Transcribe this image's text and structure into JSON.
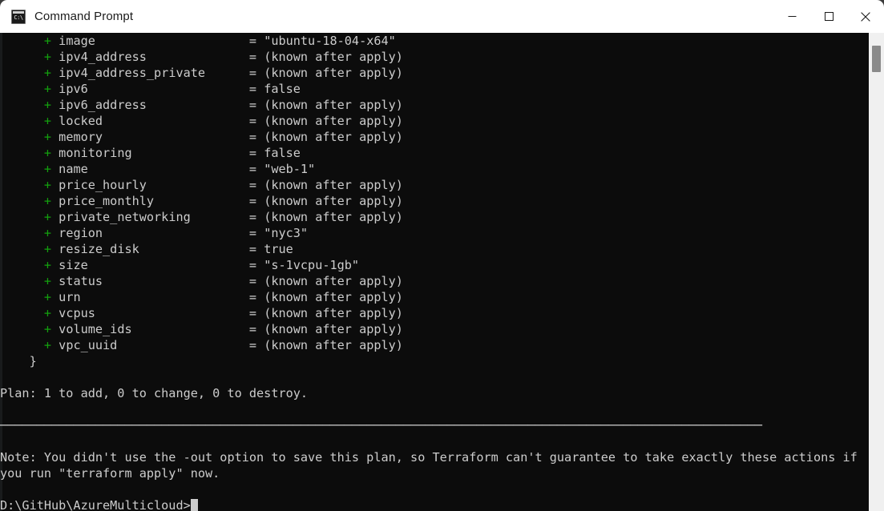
{
  "window": {
    "title": "Command Prompt",
    "icon": "cmd-prompt-icon",
    "icon_glyph": "C:\\",
    "controls": {
      "minimize": "Minimize",
      "maximize": "Maximize",
      "close": "Close"
    },
    "colors": {
      "titlebar_bg": "#ffffff",
      "titlebar_fg": "#1b1b1b",
      "terminal_bg": "#0c0c0c",
      "terminal_fg": "#cccccc",
      "accent_green": "#13a10e",
      "scrollbar_track": "#f0f0f0",
      "scrollbar_thumb": "#8a8a8a"
    }
  },
  "terminal": {
    "prompt": "D:\\GitHub\\AzureMulticloud>",
    "cursor": "block",
    "separator": "────────────────────────────────────────────────────────────────────────────────────────────────────────",
    "attributes": [
      {
        "marker": "+",
        "name": "image",
        "value": "\"ubuntu-18-04-x64\""
      },
      {
        "marker": "+",
        "name": "ipv4_address",
        "value": "(known after apply)"
      },
      {
        "marker": "+",
        "name": "ipv4_address_private",
        "value": "(known after apply)"
      },
      {
        "marker": "+",
        "name": "ipv6",
        "value": "false"
      },
      {
        "marker": "+",
        "name": "ipv6_address",
        "value": "(known after apply)"
      },
      {
        "marker": "+",
        "name": "locked",
        "value": "(known after apply)"
      },
      {
        "marker": "+",
        "name": "memory",
        "value": "(known after apply)"
      },
      {
        "marker": "+",
        "name": "monitoring",
        "value": "false"
      },
      {
        "marker": "+",
        "name": "name",
        "value": "\"web-1\""
      },
      {
        "marker": "+",
        "name": "price_hourly",
        "value": "(known after apply)"
      },
      {
        "marker": "+",
        "name": "price_monthly",
        "value": "(known after apply)"
      },
      {
        "marker": "+",
        "name": "private_networking",
        "value": "(known after apply)"
      },
      {
        "marker": "+",
        "name": "region",
        "value": "\"nyc3\""
      },
      {
        "marker": "+",
        "name": "resize_disk",
        "value": "true"
      },
      {
        "marker": "+",
        "name": "size",
        "value": "\"s-1vcpu-1gb\""
      },
      {
        "marker": "+",
        "name": "status",
        "value": "(known after apply)"
      },
      {
        "marker": "+",
        "name": "urn",
        "value": "(known after apply)"
      },
      {
        "marker": "+",
        "name": "vcpus",
        "value": "(known after apply)"
      },
      {
        "marker": "+",
        "name": "volume_ids",
        "value": "(known after apply)"
      },
      {
        "marker": "+",
        "name": "vpc_uuid",
        "value": "(known after apply)"
      }
    ],
    "closing_brace": "}",
    "plan_summary": "Plan: 1 to add, 0 to change, 0 to destroy.",
    "note_line_1": "Note: You didn't use the -out option to save this plan, so Terraform can't guarantee to take exactly these actions if",
    "note_line_2": "you run \"terraform apply\" now."
  }
}
